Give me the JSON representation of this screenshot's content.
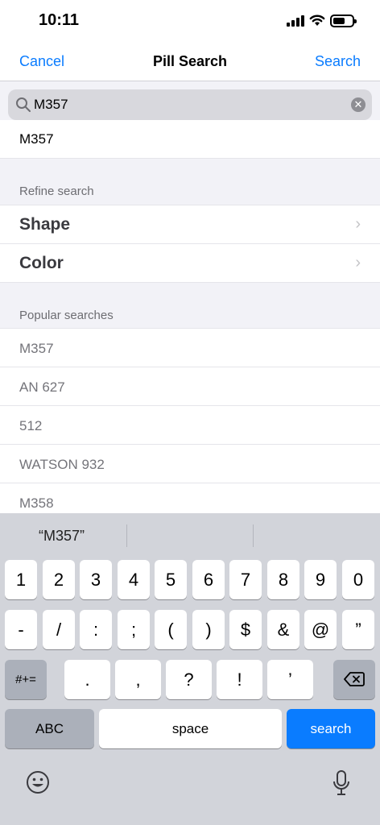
{
  "status": {
    "time": "10:11"
  },
  "nav": {
    "cancel": "Cancel",
    "title": "Pill Search",
    "search": "Search"
  },
  "search": {
    "value": "M357",
    "suggestion": "M357"
  },
  "refine": {
    "header": "Refine search",
    "items": [
      "Shape",
      "Color"
    ]
  },
  "popular": {
    "header": "Popular searches",
    "items": [
      "M357",
      "AN 627",
      "512",
      "WATSON 932",
      "M358"
    ]
  },
  "keyboard": {
    "prediction": "“M357”",
    "row1": [
      "1",
      "2",
      "3",
      "4",
      "5",
      "6",
      "7",
      "8",
      "9",
      "0"
    ],
    "row2": [
      "-",
      "/",
      ":",
      ";",
      "(",
      ")",
      "$",
      "&",
      "@",
      "”"
    ],
    "row3_toggle": "#+=",
    "row3": [
      ".",
      ",",
      "?",
      "!",
      "’"
    ],
    "abc": "ABC",
    "space": "space",
    "go": "search"
  },
  "colors": {
    "accent": "#0a7cff"
  }
}
